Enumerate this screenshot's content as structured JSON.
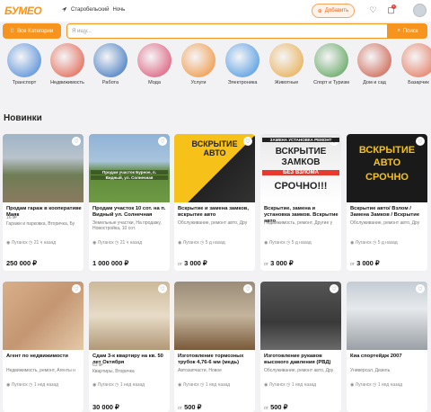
{
  "header": {
    "logo": "БУМЕО",
    "location": "Старобельский",
    "location_extra": "Ночь",
    "add_button": "Добавить",
    "notifications_count": "0"
  },
  "search": {
    "all_categories": "Все Категории",
    "placeholder": "Я ищу...",
    "button": "Поиск"
  },
  "categories": [
    {
      "label": "Транспорт",
      "color": "#3d7fd4"
    },
    {
      "label": "Недвижимость",
      "color": "#e0523b"
    },
    {
      "label": "Работа",
      "color": "#2a69b8"
    },
    {
      "label": "Мода",
      "color": "#d94668"
    },
    {
      "label": "Услуги",
      "color": "#ef8a2c"
    },
    {
      "label": "Электроника",
      "color": "#3a8de0"
    },
    {
      "label": "Животные",
      "color": "#e7a43c"
    },
    {
      "label": "Спорт и Туризм",
      "color": "#4c9a4a"
    },
    {
      "label": "Дом и сад",
      "color": "#c8503a"
    },
    {
      "label": "Базарчик",
      "color": "#e26a4a"
    }
  ],
  "section_title": "Новинки",
  "cards": [
    {
      "title": "Продам гараж в кооперативе Маяк",
      "desc": "Гаражи и парковка, Вторичка, Бу",
      "extra": "16 м²",
      "city": "Луганск",
      "time": "21 ч назад",
      "price": "250 000 ₽",
      "prefix": ""
    },
    {
      "title": "Продам участок 10 сот. на п. Видный ул. Солнечная",
      "desc": "Земельные участки, На продажу, Новостройка, 10 сот.",
      "extra": "",
      "city": "Луганск",
      "time": "21 ч назад",
      "price": "1 000 000 ₽",
      "prefix": ""
    },
    {
      "title": "Вскрытие и замена замков, вскрытие авто",
      "desc": "Обслуживание, ремонт авто, Дру",
      "extra": "",
      "city": "Луганск",
      "time": "5 д назад",
      "price": "3 000 ₽",
      "prefix": "от"
    },
    {
      "title": "Вскрытие, замена и установка замков. Вскрытие авто",
      "desc": "Недвижимость, ремонт, Другие у",
      "extra": "",
      "city": "Луганск",
      "time": "5 д назад",
      "price": "3 000 ₽",
      "prefix": "от"
    },
    {
      "title": "Вскрытие авто/ Взлом / Замена Замков / Вскрытие",
      "desc": "Обслуживание, ремонт авто, Дру",
      "extra": "",
      "city": "Луганск",
      "time": "5 д назад",
      "price": "3 000 ₽",
      "prefix": "от"
    },
    {
      "title": "Агент по недвижимости",
      "desc": "Недвижимость, ремонт, Агенты н",
      "extra": "",
      "city": "Луганск",
      "time": "1 нед назад",
      "price": "",
      "prefix": ""
    },
    {
      "title": "Сдам 3-к квартиру на кв. 50 лет Октября",
      "desc": "Квартиры, Вторичка",
      "extra": "63 м²",
      "city": "Луганск",
      "time": "1 нед назад",
      "price": "30 000 ₽",
      "prefix": ""
    },
    {
      "title": "Изготовление тормозных трубок 4,76-6 мм (медь)",
      "desc": "Автозапчасти, Новое",
      "extra": "",
      "city": "Луганск",
      "time": "1 нед назад",
      "price": "500 ₽",
      "prefix": "от"
    },
    {
      "title": "Изготовление рукавов высокого давления (РВД)",
      "desc": "Обслуживание, ремонт авто, Дру",
      "extra": "",
      "city": "Луганск",
      "time": "1 нед назад",
      "price": "500 ₽",
      "prefix": "от"
    },
    {
      "title": "Киа спортейдж 2007",
      "desc": "Универсал, Дизель",
      "extra": "",
      "city": "Луганск",
      "time": "1 нед назад",
      "price": "",
      "prefix": ""
    }
  ],
  "ad_texts": {
    "card2_line1": "ВСКРЫТИЕ",
    "card2_line2": "АВТО",
    "card3_line1": "ЗАМЕНА УСТАНОВКА РЕМОНТ",
    "card3_line2": "ВСКРЫТИЕ",
    "card3_line3": "ЗАМКОВ",
    "card3_line4": "БЕЗ ВЗЛОМА",
    "card3_line5": "СРОЧНО!!!",
    "card4_line1": "ВСКРЫТИЕ",
    "card4_line2": "АВТО",
    "card4_line3": "СРОЧНО",
    "card1_line1": "Продам участок Бурное, п.",
    "card1_line2": "Видный, ул. Солнечная"
  }
}
